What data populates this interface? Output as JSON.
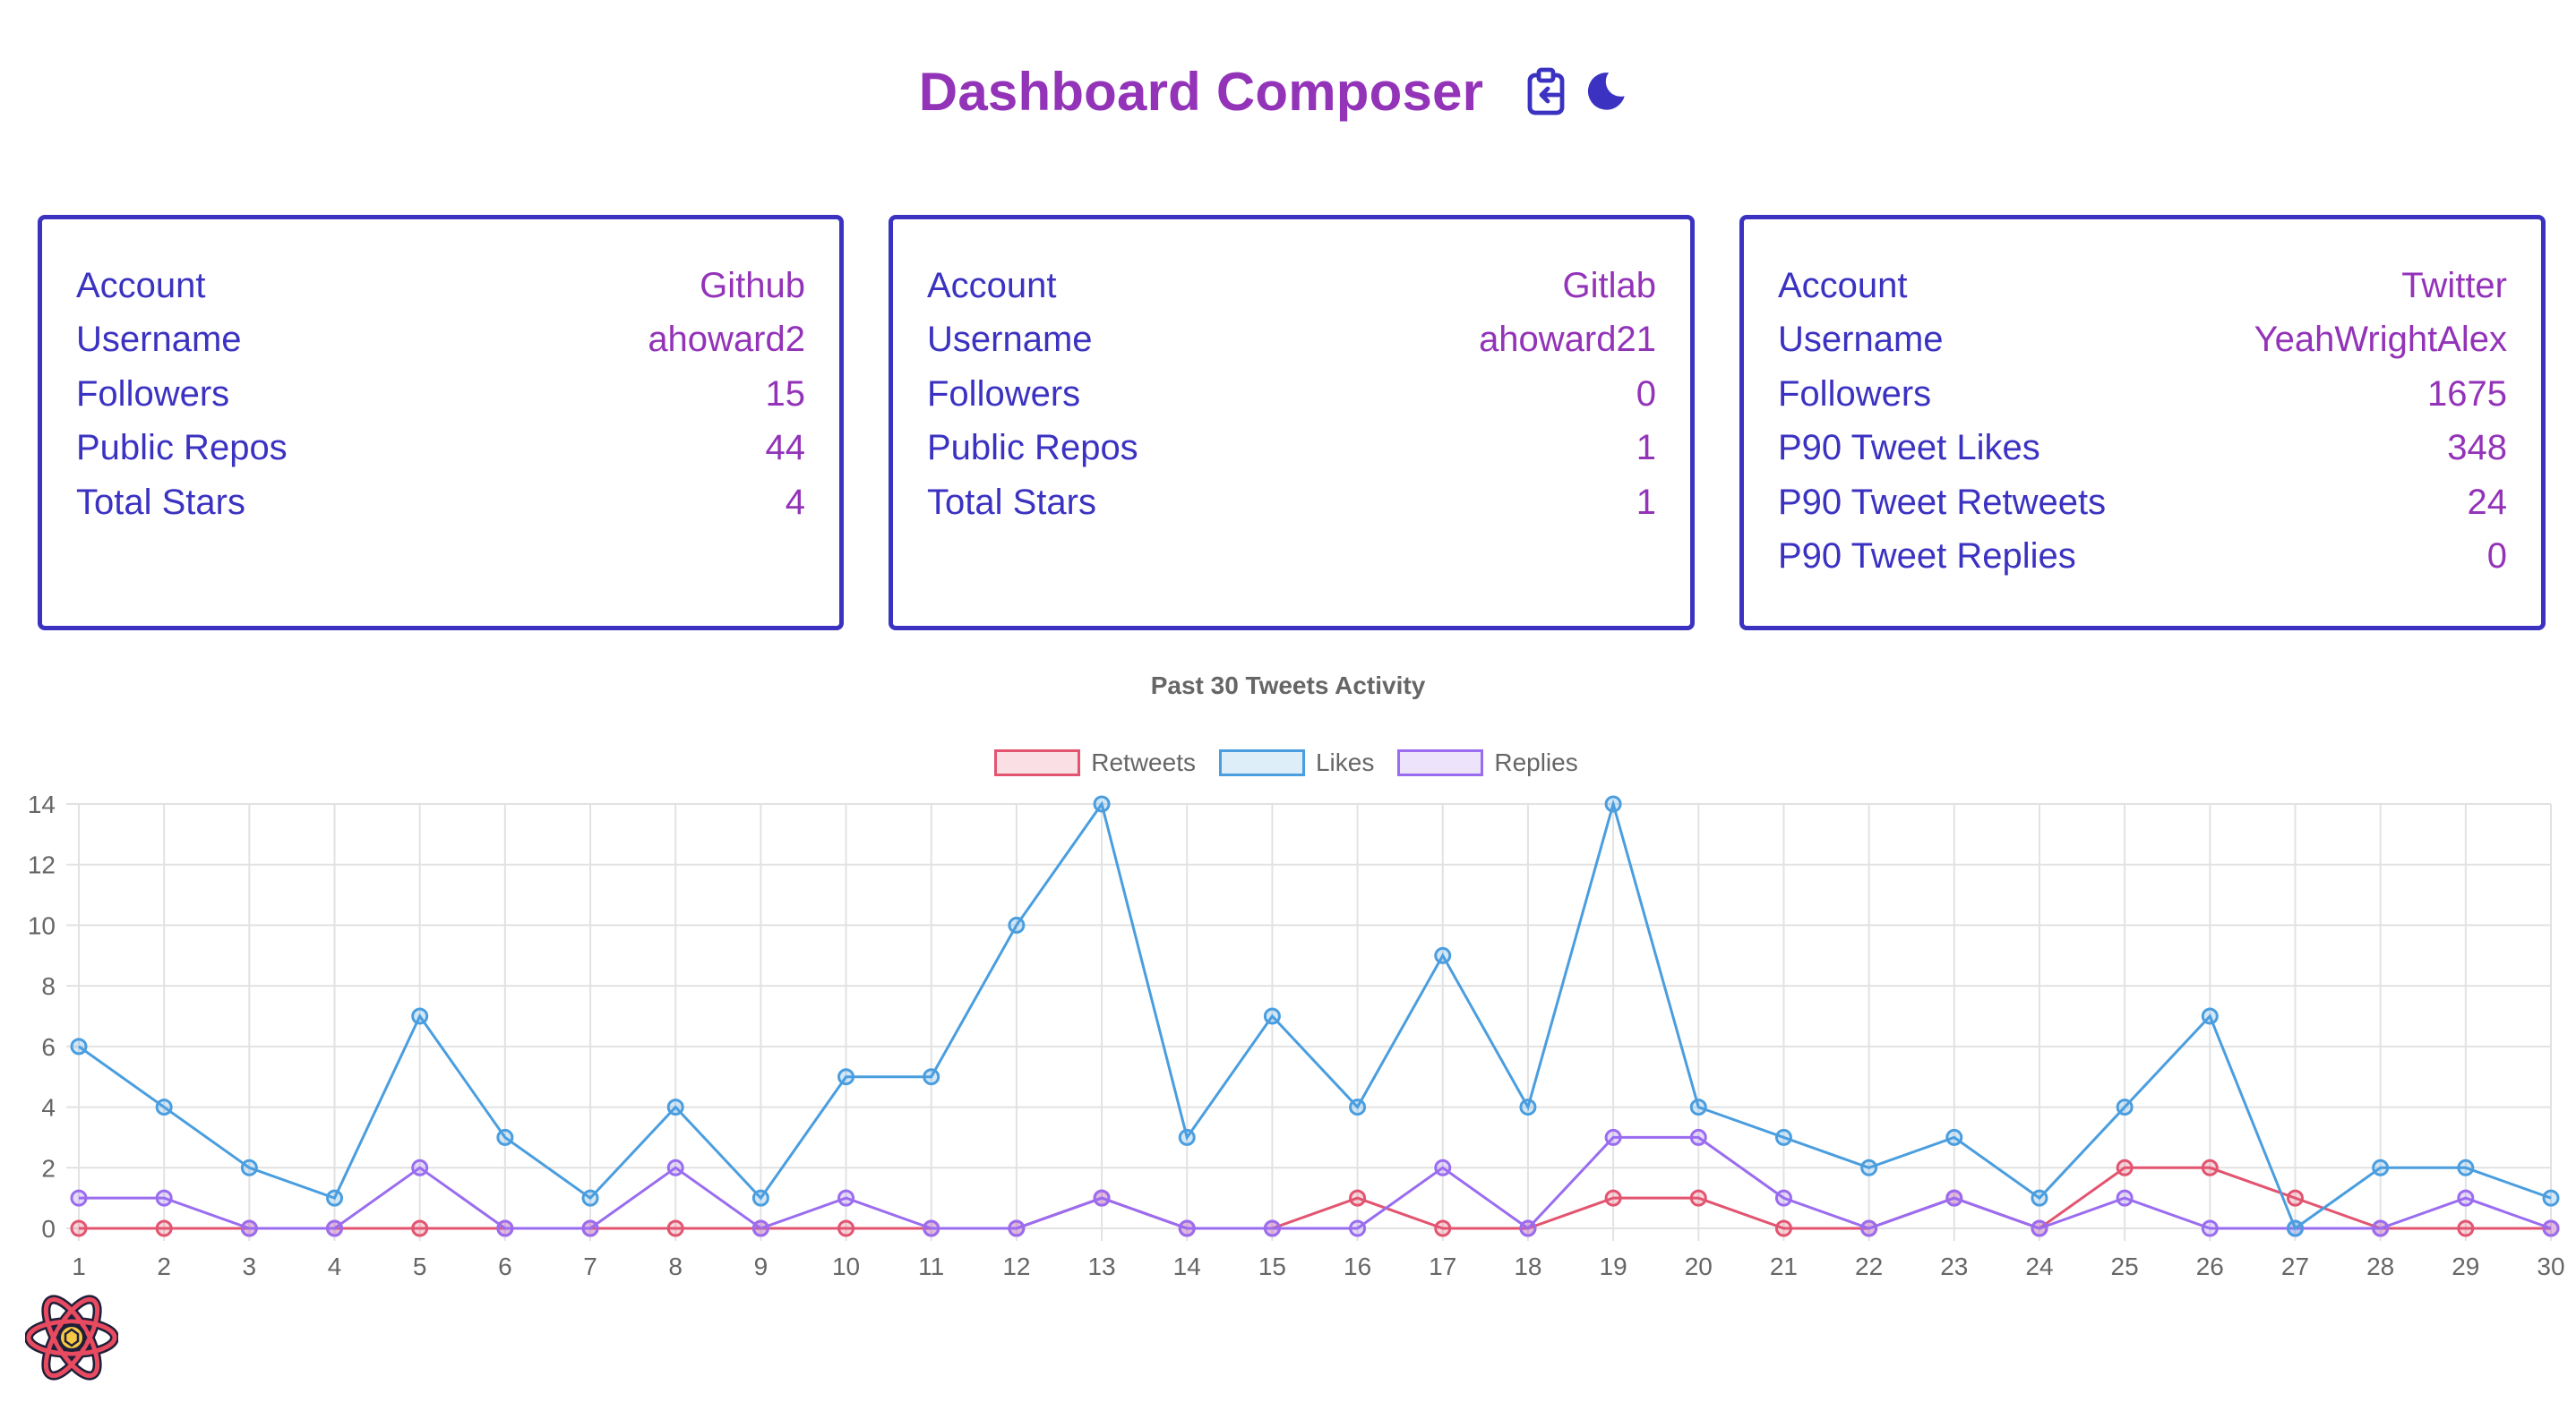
{
  "header": {
    "title": "Dashboard Composer",
    "copy_icon": "clipboard-copy-icon",
    "theme_icon": "moon-icon"
  },
  "cards": [
    {
      "rows": [
        {
          "label": "Account",
          "value": "Github"
        },
        {
          "label": "Username",
          "value": "ahoward2"
        },
        {
          "label": "Followers",
          "value": "15"
        },
        {
          "label": "Public Repos",
          "value": "44"
        },
        {
          "label": "Total Stars",
          "value": "4"
        }
      ]
    },
    {
      "rows": [
        {
          "label": "Account",
          "value": "Gitlab"
        },
        {
          "label": "Username",
          "value": "ahoward21"
        },
        {
          "label": "Followers",
          "value": "0"
        },
        {
          "label": "Public Repos",
          "value": "1"
        },
        {
          "label": "Total Stars",
          "value": "1"
        }
      ]
    },
    {
      "rows": [
        {
          "label": "Account",
          "value": "Twitter"
        },
        {
          "label": "Username",
          "value": "YeahWrightAlex"
        },
        {
          "label": "Followers",
          "value": "1675"
        },
        {
          "label": "P90 Tweet Likes",
          "value": "348"
        },
        {
          "label": "P90 Tweet Retweets",
          "value": "24"
        },
        {
          "label": "P90 Tweet Replies",
          "value": "0"
        }
      ]
    }
  ],
  "colors": {
    "title": "#9333b8",
    "accent": "#3b32c1",
    "retweets": "#e2546f",
    "likes": "#4a9edf",
    "replies": "#9a6cf0"
  },
  "footer": {
    "logo_icon": "react-atom-logo-icon"
  },
  "chart_data": {
    "type": "line",
    "title": "Past 30 Tweets Activity",
    "xlabel": "",
    "ylabel": "",
    "x": [
      1,
      2,
      3,
      4,
      5,
      6,
      7,
      8,
      9,
      10,
      11,
      12,
      13,
      14,
      15,
      16,
      17,
      18,
      19,
      20,
      21,
      22,
      23,
      24,
      25,
      26,
      27,
      28,
      29,
      30
    ],
    "ylim": [
      0,
      14
    ],
    "yticks": [
      0,
      2,
      4,
      6,
      8,
      10,
      12,
      14
    ],
    "grid": true,
    "legend_position": "top",
    "series": [
      {
        "name": "Retweets",
        "values": [
          0,
          0,
          0,
          0,
          0,
          0,
          0,
          0,
          0,
          0,
          0,
          0,
          1,
          0,
          0,
          1,
          0,
          0,
          1,
          1,
          0,
          0,
          1,
          0,
          2,
          2,
          1,
          0,
          0,
          0
        ]
      },
      {
        "name": "Likes",
        "values": [
          6,
          4,
          2,
          1,
          7,
          3,
          1,
          4,
          1,
          5,
          5,
          10,
          14,
          3,
          7,
          4,
          9,
          4,
          14,
          4,
          3,
          2,
          3,
          1,
          4,
          7,
          0,
          2,
          2,
          1
        ]
      },
      {
        "name": "Replies",
        "values": [
          1,
          1,
          0,
          0,
          2,
          0,
          0,
          2,
          0,
          1,
          0,
          0,
          1,
          0,
          0,
          0,
          2,
          0,
          3,
          3,
          1,
          0,
          1,
          0,
          1,
          0,
          0,
          0,
          1,
          0
        ]
      }
    ]
  }
}
